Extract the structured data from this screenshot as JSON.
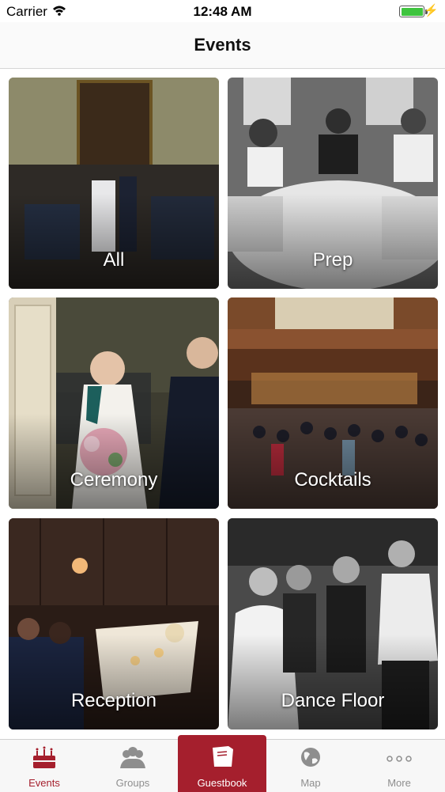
{
  "status": {
    "carrier": "Carrier",
    "time": "12:48 AM",
    "battery_level": 1.0
  },
  "nav": {
    "title": "Events"
  },
  "tiles": [
    {
      "label": "All"
    },
    {
      "label": "Prep"
    },
    {
      "label": "Ceremony"
    },
    {
      "label": "Cocktails"
    },
    {
      "label": "Reception"
    },
    {
      "label": "Dance Floor"
    }
  ],
  "tabbar": {
    "items": [
      {
        "label": "Events",
        "icon": "cake-icon"
      },
      {
        "label": "Groups",
        "icon": "group-icon"
      },
      {
        "label": "Guestbook",
        "icon": "book-icon"
      },
      {
        "label": "Map",
        "icon": "globe-icon"
      },
      {
        "label": "More",
        "icon": "more-dots-icon"
      }
    ],
    "active_color": "#a51f2d"
  }
}
